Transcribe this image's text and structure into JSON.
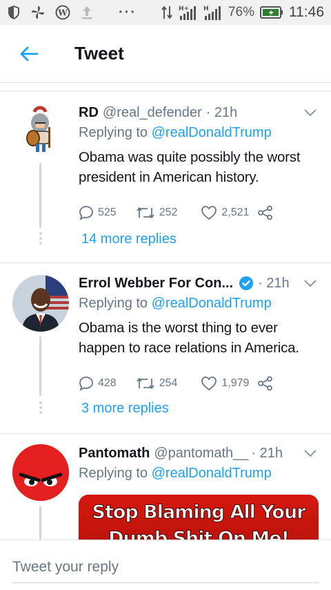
{
  "status_bar": {
    "battery_percent": "76%",
    "time": "11:46",
    "icons": [
      "shield-icon",
      "pinwheel-icon",
      "wordpress-icon",
      "upload-icon",
      "more-dots-icon",
      "data-arrows-icon",
      "signal-h-plus-icon",
      "signal-h-icon",
      "battery-icon"
    ],
    "network_1": "H+",
    "network_2": "H",
    "dots": "···"
  },
  "header": {
    "title": "Tweet",
    "back_icon": "back-arrow-icon",
    "accent": "#1da1f2"
  },
  "tweets": [
    {
      "name": "RD",
      "handle": "@real_defender",
      "time": "· 21h",
      "reply_prefix": "Replying to ",
      "reply_to": "@realDonaldTrump",
      "text": "Obama was quite possibly the worst president in American history.",
      "replies": "525",
      "retweets": "252",
      "likes": "2,521",
      "more_replies": "14 more replies",
      "avatar": "spartan-cartoon-avatar"
    },
    {
      "name": "Errol Webber For Con...",
      "verified": true,
      "handle": "",
      "time": "· 21h",
      "reply_prefix": "Replying to ",
      "reply_to": "@realDonaldTrump",
      "text": "Obama is the worst thing to ever happen to race relations in America.",
      "replies": "428",
      "retweets": "254",
      "likes": "1,979",
      "more_replies": "3 more replies",
      "avatar": "man-portrait-avatar"
    },
    {
      "name": "Pantomath",
      "handle": "@pantomath__",
      "time": "· 21h",
      "reply_prefix": "Replying to ",
      "reply_to": "@realDonaldTrump",
      "media_text_1": "Stop Blaming All Your",
      "media_text_2": "Dumb Shit On Me!",
      "avatar": "angry-red-face-avatar"
    }
  ],
  "reply_bar": {
    "placeholder": "Tweet your reply"
  }
}
